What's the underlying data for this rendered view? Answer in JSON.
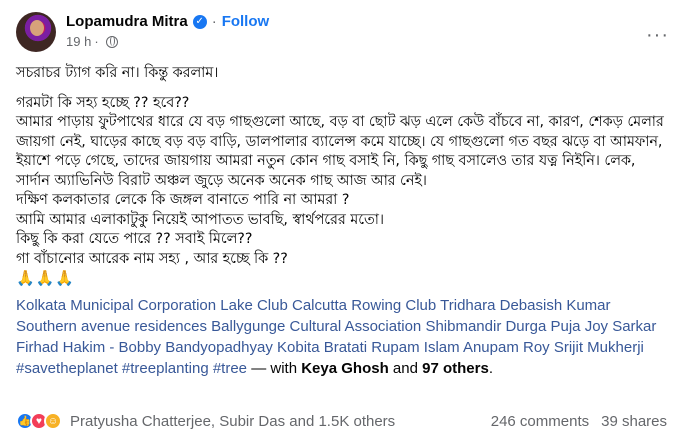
{
  "post": {
    "author": "Lopamudra Mitra",
    "separator": "·",
    "follow_label": "Follow",
    "time": "19 h",
    "time_separator": "·",
    "more_label": "···",
    "lines": {
      "l1": "সচরাচর ট্যাগ করি না। কিন্তু করলাম।",
      "l2": "গরমটা কি সহ্য হচ্ছে ?? হবে??",
      "l3": "আমার পাড়ায় ফুটপাথের ধারে যে বড় গাছগুলো আছে, বড় বা ছোট ঝড় এলে কেউ বাঁচবে না, কারণ, শেকড় মেলার জায়গা নেই, ঘাড়ের কাছে বড় বড় বাড়ি, ডালপালার ব্যালেন্স কমে যাচ্ছে। যে গাছগুলো গত বছর ঝড়ে বা আমফান, ইয়াশে পড়ে গেছে, তাদের জায়গায় আমরা নতুন কোন গাছ বসাই নি, কিছু গাছ বসালেও তার যত্ন নিইনি। লেক, সার্দান অ্যাভিনিউ বিরাট অঞ্চল জুড়ে অনেক অনেক গাছ আজ আর নেই।",
      "l4": "দক্ষিণ কলকাতার লেকে কি  জঙ্গল বানাতে পারি না আমরা ?",
      "l5": "আমি আমার এলাকাটুকু নিয়েই আপাতত ভাবছি, স্বার্থপরের মতো।",
      "l6": "কিছু কি করা যেতে পারে ?? সবাই মিলে??",
      "l7": "গা বাঁচানোর আরেক নাম সহ্য , আর হচ্ছে কি ??",
      "emojis": "🙏🙏🙏"
    },
    "tags": [
      "Kolkata Municipal Corporation",
      "Lake Club Calcutta",
      "Rowing Club Tridhara",
      "Debasish Kumar",
      "Southern avenue residences",
      "Ballygunge Cultural Association",
      "Shibmandir Durga Puja",
      "Joy Sarkar",
      "Firhad Hakim - Bobby",
      "Bandyopadhyay",
      "Kobita",
      "Bratati",
      "Rupam Islam",
      "Anupam Roy",
      "Srijit Mukherji",
      "#savetheplanet",
      "#treeplanting",
      "#tree"
    ],
    "with_text": " — with ",
    "with_person": "Keya Ghosh",
    "and_text": " and ",
    "others_label": "97 others",
    "period": "."
  },
  "footer": {
    "reaction_names": "Pratyusha Chatterjee, Subir Das and 1.5K others",
    "comments": "246 comments",
    "shares": "39 shares"
  }
}
